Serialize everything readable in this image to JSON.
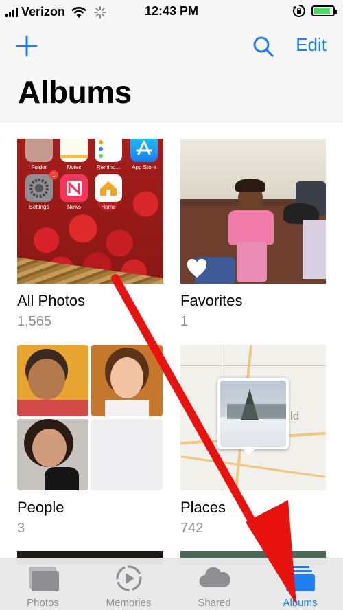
{
  "status_bar": {
    "carrier": "Verizon",
    "time": "12:43 PM",
    "battery_level": 0.85
  },
  "nav": {
    "edit_label": "Edit",
    "title": "Albums"
  },
  "albums": [
    {
      "name": "All Photos",
      "count": "1,565"
    },
    {
      "name": "Favorites",
      "count": "1"
    },
    {
      "name": "People",
      "count": "3"
    },
    {
      "name": "Places",
      "count": "742"
    }
  ],
  "home_screen_apps": [
    {
      "label": "Folder"
    },
    {
      "label": "Notes"
    },
    {
      "label": "Remind..."
    },
    {
      "label": "App Store"
    },
    {
      "label": "Settings",
      "badge": "1"
    },
    {
      "label": "News"
    },
    {
      "label": "Home"
    }
  ],
  "map_label": "ld",
  "tabs": [
    {
      "label": "Photos",
      "icon": "photos-icon",
      "active": false
    },
    {
      "label": "Memories",
      "icon": "memories-icon",
      "active": false
    },
    {
      "label": "Shared",
      "icon": "cloud-icon",
      "active": false
    },
    {
      "label": "Albums",
      "icon": "albums-icon",
      "active": true
    }
  ],
  "colors": {
    "accent": "#1f7ff0",
    "annotation_arrow": "#e8130f",
    "battery": "#4cd964"
  }
}
